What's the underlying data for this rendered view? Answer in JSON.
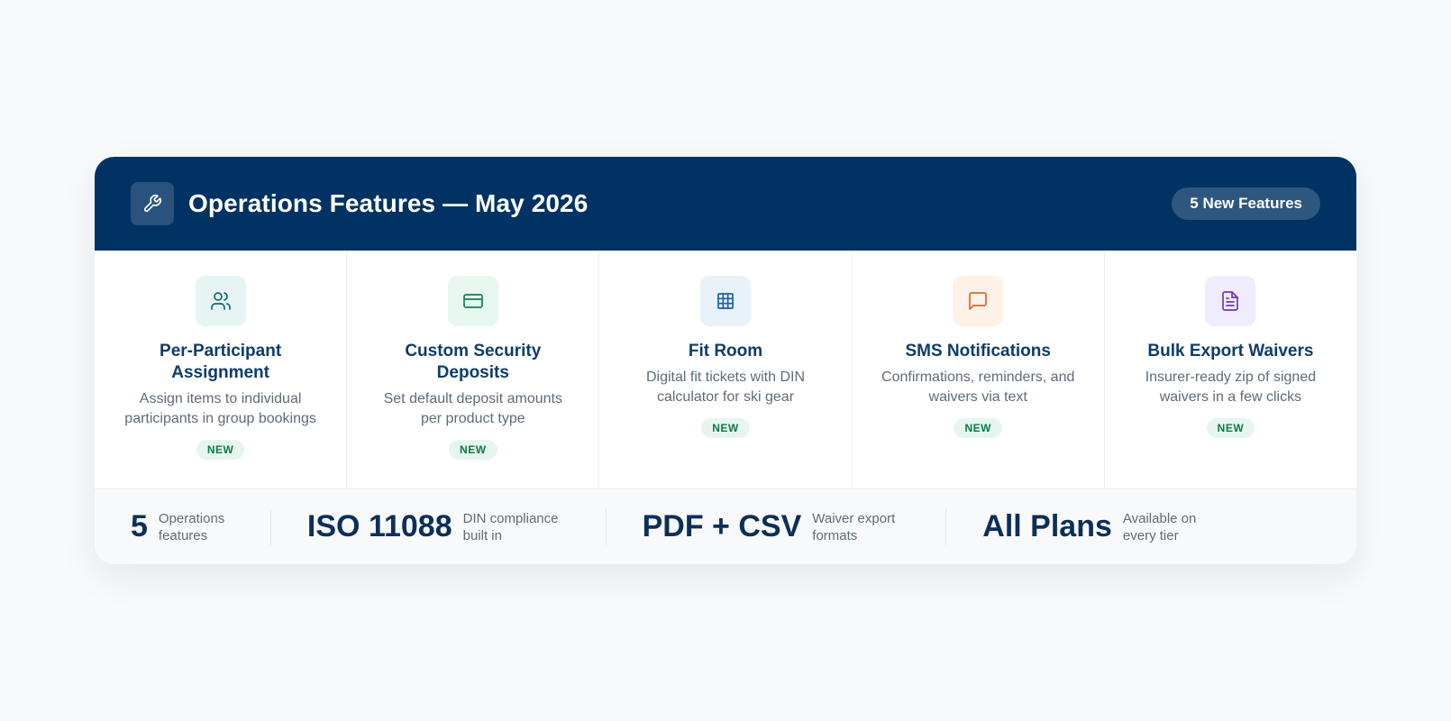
{
  "header": {
    "title": "Operations Features — May 2026",
    "badge": "5 New Features",
    "icon": "wrench-icon"
  },
  "features": [
    {
      "title": "Per-Participant Assignment",
      "description": "Assign items to individual participants in group bookings",
      "badge": "NEW",
      "icon": "users-icon",
      "icon_color": "#0e6b6b",
      "icon_bg": "#e6f5f4"
    },
    {
      "title": "Custom Security Deposits",
      "description": "Set default deposit amounts per product type",
      "badge": "NEW",
      "icon": "credit-card-icon",
      "icon_color": "#12805a",
      "icon_bg": "#e8f7ef"
    },
    {
      "title": "Fit Room",
      "description": "Digital fit tickets with DIN calculator for ski gear",
      "badge": "NEW",
      "icon": "grid-icon",
      "icon_color": "#1d5fa8",
      "icon_bg": "#e8f2fb"
    },
    {
      "title": "SMS Notifications",
      "description": "Confirmations, reminders, and waivers via text",
      "badge": "NEW",
      "icon": "message-icon",
      "icon_color": "#d9692a",
      "icon_bg": "#fdf1e8"
    },
    {
      "title": "Bulk Export Waivers",
      "description": "Insurer-ready zip of signed waivers in a few clicks",
      "badge": "NEW",
      "icon": "document-icon",
      "icon_color": "#6a3bbf",
      "icon_bg": "#f1ecfb"
    }
  ],
  "stats": [
    {
      "value": "5",
      "label": "Operations features"
    },
    {
      "value": "ISO 11088",
      "label": "DIN compliance built in"
    },
    {
      "value": "PDF + CSV",
      "label": "Waiver export formats"
    },
    {
      "value": "All Plans",
      "label": "Available on every tier"
    }
  ],
  "colors": {
    "page_bg": "#f7f9fb",
    "header_bg": "#003263",
    "title_text": "#0d3c6b",
    "body_text": "#5f6b78",
    "new_badge_bg": "#e6f6ee",
    "new_badge_text": "#0a7a45"
  }
}
